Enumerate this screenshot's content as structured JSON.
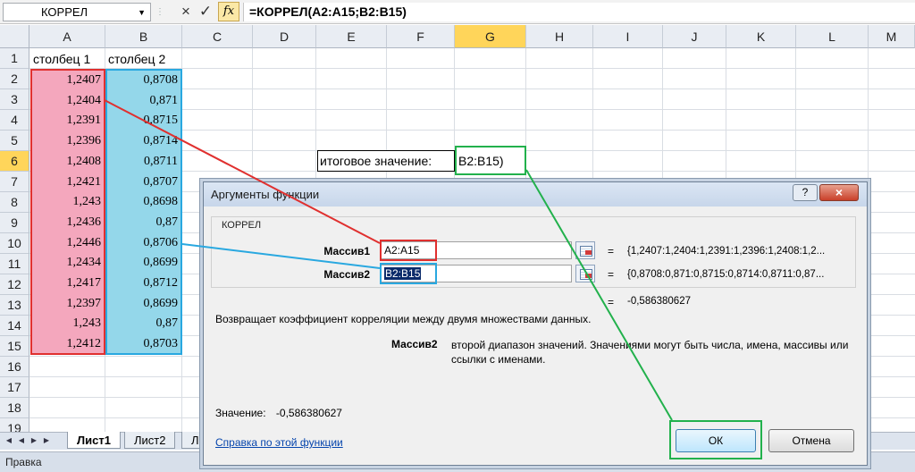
{
  "formula_bar": {
    "name_box": "КОРРЕЛ",
    "cancel_icon": "×",
    "enter_icon": "✓",
    "insert_function_icon": "fx",
    "formula": "=КОРРЕЛ(A2:A15;B2:B15)"
  },
  "columns": [
    "A",
    "B",
    "C",
    "D",
    "E",
    "F",
    "G",
    "H",
    "I",
    "J",
    "K",
    "L",
    "M"
  ],
  "selected_column": "G",
  "rows": [
    "1",
    "2",
    "3",
    "4",
    "5",
    "6",
    "7",
    "8",
    "9",
    "10",
    "11",
    "12",
    "13",
    "14",
    "15",
    "16",
    "17",
    "18",
    "19"
  ],
  "selected_row": "6",
  "sheet": {
    "header_a": "столбец 1",
    "header_b": "столбец 2",
    "col_a": [
      "1,2407",
      "1,2404",
      "1,2391",
      "1,2396",
      "1,2408",
      "1,2421",
      "1,243",
      "1,2436",
      "1,2446",
      "1,2434",
      "1,2417",
      "1,2397",
      "1,243",
      "1,2412"
    ],
    "col_b": [
      "0,8708",
      "0,871",
      "0,8715",
      "0,8714",
      "0,8711",
      "0,8707",
      "0,8698",
      "0,87",
      "0,8706",
      "0,8699",
      "0,8712",
      "0,8699",
      "0,87",
      "0,8703"
    ],
    "result_label": "итоговое значение:",
    "result_cell": "B2:B15)"
  },
  "sheet_tabs": {
    "nav_icons": [
      "first-sheet-icon",
      "prev-sheet-icon",
      "next-sheet-icon",
      "last-sheet-icon"
    ],
    "tabs": [
      "Лист1",
      "Лист2",
      "Ли"
    ]
  },
  "status_bar": {
    "mode": "Правка"
  },
  "dialog": {
    "title": "Аргументы функции",
    "help_icon": "?",
    "close_icon": "×",
    "function_name": "КОРРЕЛ",
    "arg1_label": "Массив1",
    "arg1_value": "A2:A15",
    "arg1_preview": "{1,2407:1,2404:1,2391:1,2396:1,2408:1,2...",
    "arg2_label": "Массив2",
    "arg2_value": "B2:B15",
    "arg2_preview": "{0,8708:0,871:0,8715:0,8714:0,8711:0,87...",
    "equals": "=",
    "result_preview": "-0,586380627",
    "description": "Возвращает коэффициент корреляции между двумя множествами данных.",
    "arg_help_name": "Массив2",
    "arg_help_text": "второй диапазон значений. Значениями могут быть числа, имена, массивы или ссылки с именами.",
    "value_label": "Значение:",
    "value": "-0,586380627",
    "help_link": "Справка по этой функции",
    "ok": "ОК",
    "cancel": "Отмена"
  },
  "colors": {
    "range_a": "#f4a7bd",
    "range_a_border": "#e0302f",
    "range_b": "#94d7ea",
    "range_b_border": "#29a8e0",
    "highlight_green": "#22b14c",
    "selected_header": "#ffd55a"
  }
}
